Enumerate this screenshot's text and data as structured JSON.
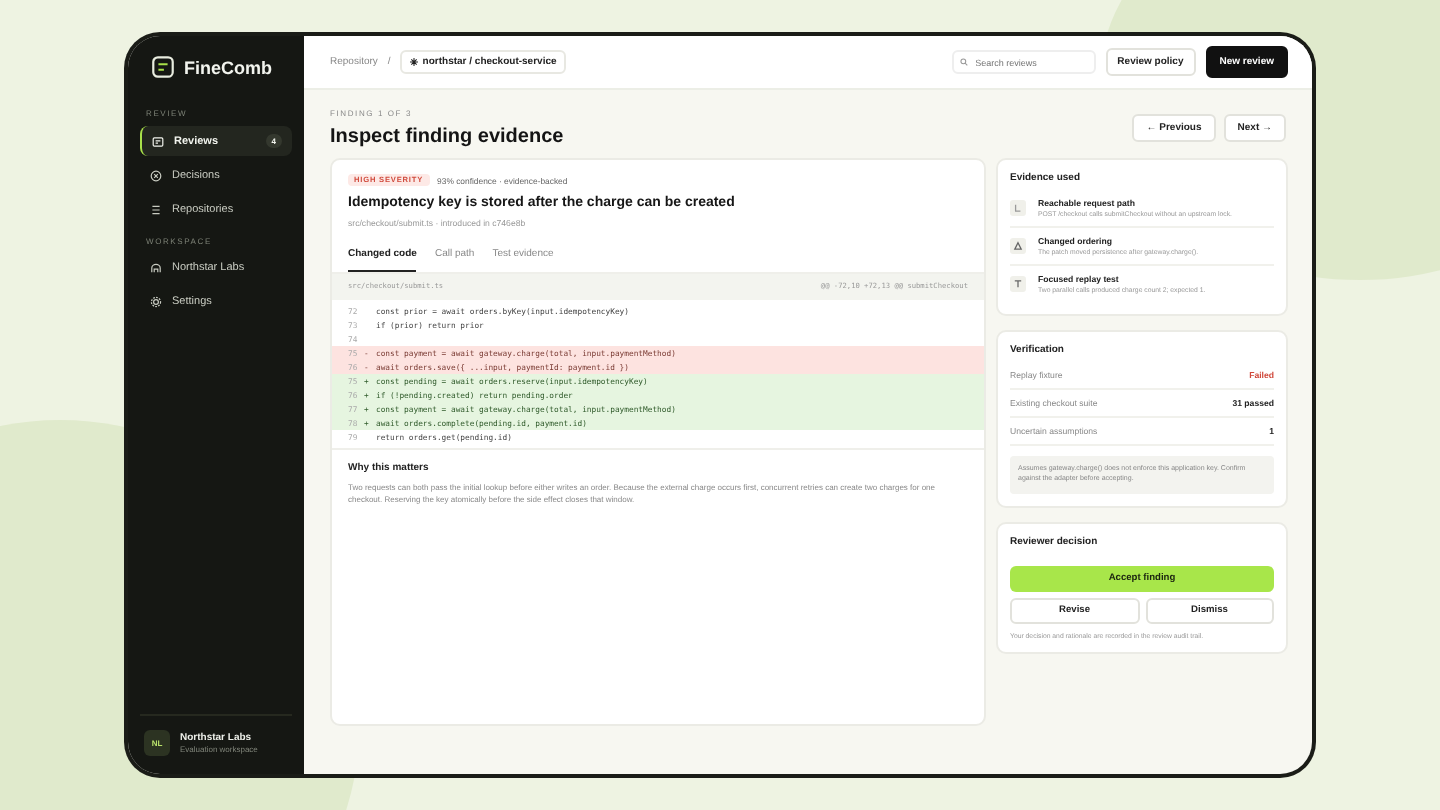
{
  "app": {
    "name": "FineComb"
  },
  "sidebar": {
    "sections": [
      {
        "heading": "REVIEW",
        "items": [
          {
            "label": "Reviews",
            "badge": "4",
            "selected": true
          },
          {
            "label": "Decisions",
            "selected": false
          },
          {
            "label": "Repositories",
            "selected": false
          }
        ]
      },
      {
        "heading": "WORKSPACE",
        "items": [
          {
            "label": "Northstar Labs",
            "selected": false
          },
          {
            "label": "Settings",
            "selected": false
          }
        ]
      }
    ],
    "account": {
      "initials": "NL",
      "name": "Northstar Labs",
      "subtitle": "Evaluation workspace"
    }
  },
  "topbar": {
    "breadcrumb": "Repository",
    "separator": "/",
    "repo": "northstar / checkout-service",
    "search": {
      "placeholder": "Search reviews"
    },
    "buttons": [
      {
        "label": "Review policy",
        "kind": "secondary"
      },
      {
        "label": "New review",
        "kind": "primary"
      }
    ]
  },
  "header": {
    "eyebrow": "FINDING 1 OF 3",
    "title": "Inspect finding evidence",
    "nav": [
      {
        "label": "← Previous"
      },
      {
        "label": "Next →"
      }
    ]
  },
  "finding": {
    "severity": "HIGH SEVERITY",
    "meta": "93% confidence · evidence-backed",
    "title": "Idempotency key is stored after the charge can be created",
    "source": "src/checkout/submit.ts · introduced in c746e8b",
    "tabs": [
      {
        "label": "Changed code",
        "selected": true
      },
      {
        "label": "Call path",
        "selected": false
      },
      {
        "label": "Test evidence",
        "selected": false
      }
    ],
    "diff": {
      "file": "src/checkout/submit.ts",
      "hunk": "@@ -72,10 +72,13 @@ submitCheckout",
      "lines": [
        {
          "number": "72",
          "kind": "context",
          "code": "const prior = await orders.byKey(input.idempotencyKey)"
        },
        {
          "number": "73",
          "kind": "context",
          "code": "if (prior) return prior"
        },
        {
          "number": "74",
          "kind": "context"
        },
        {
          "number": "75",
          "kind": "removed",
          "sign": "-",
          "code": "const payment = await gateway.charge(total, input.paymentMethod)"
        },
        {
          "number": "76",
          "kind": "removed",
          "sign": "-",
          "code": "await orders.save({ ...input, paymentId: payment.id })"
        },
        {
          "number": "75",
          "kind": "added",
          "sign": "+",
          "code": "const pending = await orders.reserve(input.idempotencyKey)"
        },
        {
          "number": "76",
          "kind": "added",
          "sign": "+",
          "code": "if (!pending.created) return pending.order"
        },
        {
          "number": "77",
          "kind": "added",
          "sign": "+",
          "code": "const payment = await gateway.charge(total, input.paymentMethod)"
        },
        {
          "number": "78",
          "kind": "added",
          "sign": "+",
          "code": "await orders.complete(pending.id, payment.id)"
        },
        {
          "number": "79",
          "kind": "context",
          "code": "return orders.get(pending.id)"
        }
      ]
    },
    "why": {
      "title": "Why this matters",
      "text": "Two requests can both pass the initial lookup before either writes an order. Because the external charge occurs first, concurrent retries can create two charges for one checkout. Reserving the key atomically before the side effect closes that window."
    }
  },
  "evidence": {
    "title": "Evidence used",
    "items": [
      {
        "title": "Reachable request path",
        "text": "POST /checkout calls submitCheckout without an upstream lock."
      },
      {
        "title": "Changed ordering",
        "text": "The patch moved persistence after gateway.charge()."
      },
      {
        "title": "Focused replay test",
        "text": "Two parallel calls produced charge count 2; expected 1."
      }
    ]
  },
  "verification": {
    "title": "Verification",
    "rows": [
      {
        "label": "Replay fixture",
        "value": "Failed",
        "kind": "fail"
      },
      {
        "label": "Existing checkout suite",
        "value": "31 passed",
        "kind": "neutral"
      },
      {
        "label": "Uncertain assumptions",
        "value": "1",
        "kind": "neutral"
      }
    ],
    "note": "Assumes gateway.charge() does not enforce this application key. Confirm against the adapter before accepting."
  },
  "decision": {
    "title": "Reviewer decision",
    "primary": "Accept finding",
    "secondary": [
      "Revise",
      "Dismiss"
    ],
    "footnote": "Your decision and rationale are recorded in the review audit trail."
  }
}
